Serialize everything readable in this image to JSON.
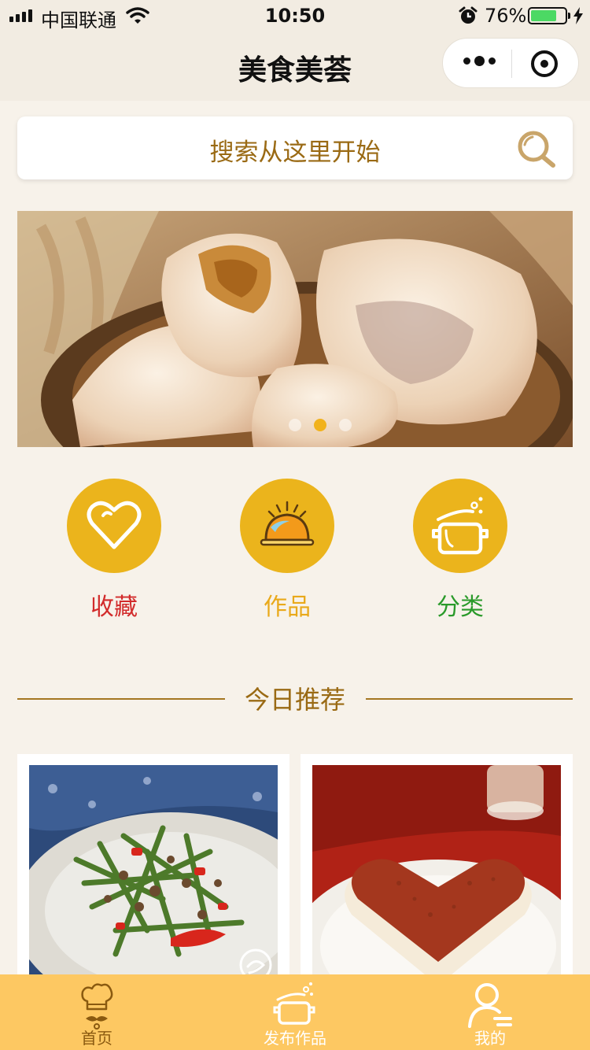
{
  "status_bar": {
    "carrier": "中国联通",
    "time": "10:50",
    "battery_percent": "76%",
    "battery_level": 0.76
  },
  "nav": {
    "title": "美食美荟",
    "more_icon": "more-dots-icon",
    "close_icon": "target-icon"
  },
  "search": {
    "placeholder": "搜索从这里开始",
    "icon": "search-icon"
  },
  "banner": {
    "slide_count": 3,
    "active_index": 1,
    "subject": "dumplings"
  },
  "shortcuts": [
    {
      "label": "收藏",
      "icon": "heart-icon",
      "label_color": "#d22b2b"
    },
    {
      "label": "作品",
      "icon": "cloche-icon",
      "label_color": "#e9a91a"
    },
    {
      "label": "分类",
      "icon": "pot-icon",
      "label_color": "#2a9a2a"
    }
  ],
  "recommend": {
    "title": "今日推荐",
    "items": [
      {
        "subject": "stir-fried-green-beans",
        "icon": "watermark-icon"
      },
      {
        "subject": "heart-tiramisu"
      }
    ]
  },
  "tabbar": {
    "items": [
      {
        "label": "首页",
        "icon": "chef-icon"
      },
      {
        "label": "发布作品",
        "icon": "pot-icon"
      },
      {
        "label": "我的",
        "icon": "user-icon"
      }
    ]
  },
  "colors": {
    "accent": "#ebb41c",
    "brown_text": "#9a6a14",
    "background": "#f7f2ea",
    "tabbar": "#fdc862"
  }
}
